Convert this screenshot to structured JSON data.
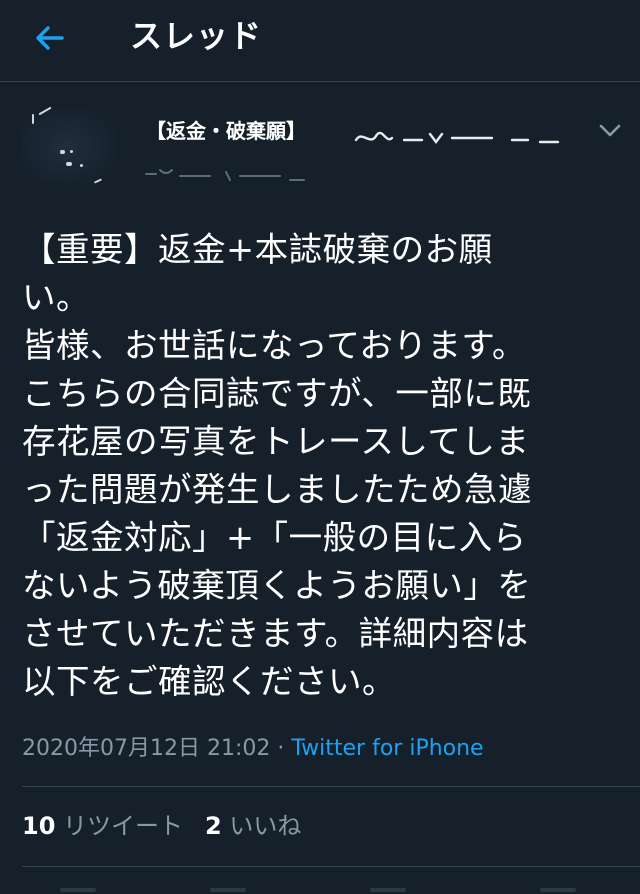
{
  "header": {
    "title": "スレッド",
    "back_icon": "arrow-left-icon"
  },
  "author": {
    "display_name": "【返金・破棄願】"
  },
  "tweet": {
    "text": "【重要】返金+本誌破棄のお願\nい。\n皆様、お世話になっております。\nこちらの合同誌ですが、一部に既\n存花屋の写真をトレースしてしま\nった問題が発生しましたため急遽\n「返金対応」+「一般の目に入ら\nないよう破棄頂くようお願い」を\nさせていただきます。詳細内容は\n以下をご確認ください。"
  },
  "meta": {
    "timestamp": "2020年07月12日 21:02",
    "separator": " · ",
    "source": "Twitter for iPhone"
  },
  "stats": {
    "retweets_count": "10",
    "retweets_label": "リツイート",
    "likes_count": "2",
    "likes_label": "いいね"
  },
  "colors": {
    "background": "#15202b",
    "accent": "#1da1f2",
    "secondary_text": "#8899a6",
    "divider": "#38444d"
  }
}
